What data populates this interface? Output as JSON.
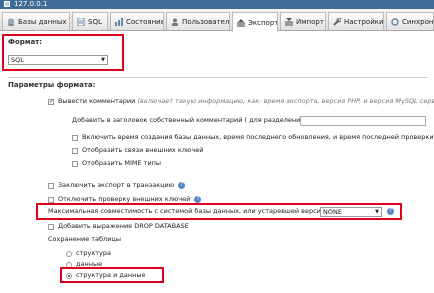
{
  "server": {
    "name": "127.0.0.1"
  },
  "tabs": [
    {
      "label": "Базы данных",
      "icon": "database-icon"
    },
    {
      "label": "SQL",
      "icon": "sql-icon"
    },
    {
      "label": "Состояние",
      "icon": "status-icon"
    },
    {
      "label": "Пользователи",
      "icon": "users-icon"
    },
    {
      "label": "Экспорт",
      "icon": "export-icon",
      "active": true
    },
    {
      "label": "Импорт",
      "icon": "import-icon"
    },
    {
      "label": "Настройки",
      "icon": "settings-icon"
    },
    {
      "label": "Синхрони",
      "icon": "sync-icon"
    }
  ],
  "format": {
    "label": "Формат:",
    "selected": "SQL"
  },
  "format_options": {
    "heading": "Параметры формата:",
    "comments": {
      "label": "Вывести комментарии",
      "note": "(включает такую информацию, как: время экспорта, версия PHP, и версия MySQL сервера)",
      "checked": true
    },
    "own_comment_label": "Добавить в заголовок собственный комментарий ( для разделения строк):",
    "own_comment_value": "",
    "include_times": "Включить время создания базы данных, время последнего обновления, и время последней проверки",
    "fk_links": "Отобразить связи внешних ключей",
    "mime_types": "Отобразить MIME типы",
    "transaction": "Заключить экспорт в транзакцию",
    "disable_fk": "Отключить проверку внешних ключей",
    "compat_label": "Максимальная совместимость с системой базы данных, или устаревшей версией MySQL:",
    "compat_value": "NONE",
    "drop_database": "Добавить выражение DROP DATABASE",
    "save_tables_label": "Сохранение таблицы",
    "save_options": [
      {
        "label": "структура",
        "checked": false
      },
      {
        "label": "данные",
        "checked": false
      },
      {
        "label": "структура и данные",
        "checked": true
      }
    ]
  },
  "colors": {
    "highlight": "#e0001b",
    "help": "#5a84c4",
    "titlebar": "#3f6b96"
  }
}
